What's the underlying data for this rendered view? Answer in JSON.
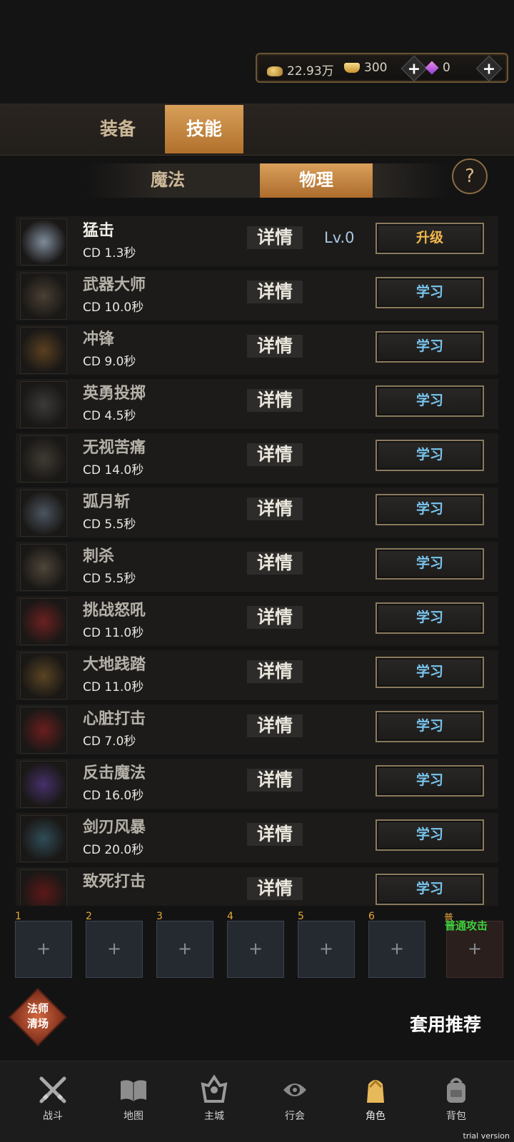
{
  "currency": {
    "gold": "22.93万",
    "ingot": "300",
    "gem": "0",
    "gold_icon": "gold-coins-icon",
    "ingot_icon": "gold-ingot-icon",
    "gem_icon": "diamond-icon"
  },
  "main_tabs": [
    {
      "label": "装备",
      "active": false
    },
    {
      "label": "技能",
      "active": true
    }
  ],
  "sub_tabs": [
    {
      "label": "魔法",
      "active": false
    },
    {
      "label": "物理",
      "active": true
    }
  ],
  "help_label": "?",
  "skills": [
    {
      "name": "猛击",
      "cd": "CD 1.3秒",
      "detail": "详情",
      "level": "Lv.0",
      "action": "升级"
    },
    {
      "name": "武器大师",
      "cd": "CD 10.0秒",
      "detail": "详情",
      "level": "",
      "action": "学习"
    },
    {
      "name": "冲锋",
      "cd": "CD 9.0秒",
      "detail": "详情",
      "level": "",
      "action": "学习"
    },
    {
      "name": "英勇投掷",
      "cd": "CD 4.5秒",
      "detail": "详情",
      "level": "",
      "action": "学习"
    },
    {
      "name": "无视苦痛",
      "cd": "CD 14.0秒",
      "detail": "详情",
      "level": "",
      "action": "学习"
    },
    {
      "name": "弧月斩",
      "cd": "CD 5.5秒",
      "detail": "详情",
      "level": "",
      "action": "学习"
    },
    {
      "name": "刺杀",
      "cd": "CD 5.5秒",
      "detail": "详情",
      "level": "",
      "action": "学习"
    },
    {
      "name": "挑战怒吼",
      "cd": "CD 11.0秒",
      "detail": "详情",
      "level": "",
      "action": "学习"
    },
    {
      "name": "大地践踏",
      "cd": "CD 11.0秒",
      "detail": "详情",
      "level": "",
      "action": "学习"
    },
    {
      "name": "心脏打击",
      "cd": "CD 7.0秒",
      "detail": "详情",
      "level": "",
      "action": "学习"
    },
    {
      "name": "反击魔法",
      "cd": "CD 16.0秒",
      "detail": "详情",
      "level": "",
      "action": "学习"
    },
    {
      "name": "剑刃风暴",
      "cd": "CD 20.0秒",
      "detail": "详情",
      "level": "",
      "action": "学习"
    },
    {
      "name": "致死打击",
      "cd": "",
      "detail": "详情",
      "level": "",
      "action": "学习"
    }
  ],
  "slots": [
    "1",
    "2",
    "3",
    "4",
    "5",
    "6"
  ],
  "basic_attack": {
    "prefix": "普",
    "label": "普通攻击"
  },
  "clear_badge": "法师\n清场",
  "recommend_label": "套用推荐",
  "nav": [
    {
      "label": "战斗",
      "icon": "crossed-swords-icon"
    },
    {
      "label": "地图",
      "icon": "book-map-icon"
    },
    {
      "label": "主城",
      "icon": "castle-icon"
    },
    {
      "label": "行会",
      "icon": "guild-emblem-icon"
    },
    {
      "label": "角色",
      "icon": "character-icon"
    },
    {
      "label": "背包",
      "icon": "backpack-icon"
    }
  ],
  "trial_label": "trial version",
  "colors": {
    "accent": "#c8873e",
    "learn": "#79c5ee",
    "upgrade": "#f1b84a",
    "basic_attack": "#3cd23c"
  }
}
